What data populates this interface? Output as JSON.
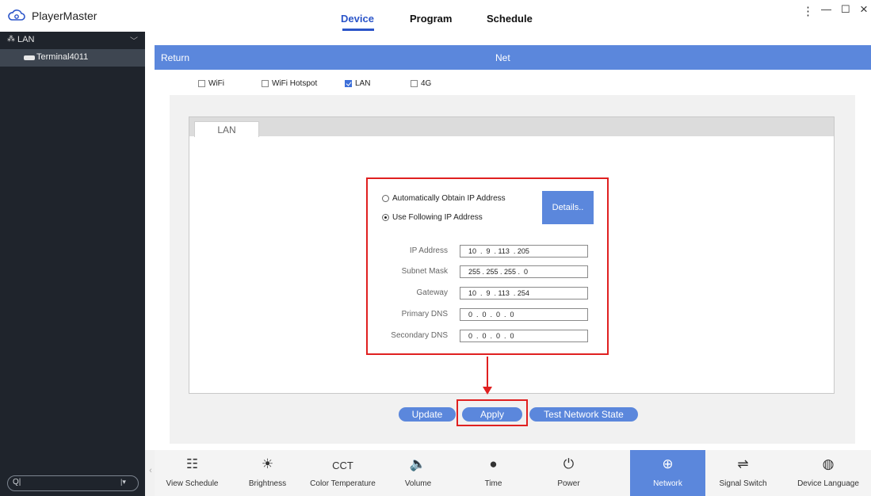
{
  "app": {
    "title": "PlayerMaster"
  },
  "nav": {
    "tabs": [
      {
        "label": "Device"
      },
      {
        "label": "Program"
      },
      {
        "label": "Schedule"
      }
    ],
    "active": "Device"
  },
  "window": {
    "menu": "⋮",
    "minimize": "—",
    "maximize": "☐",
    "close": "×"
  },
  "sidebar": {
    "root": {
      "label": "LAN"
    },
    "items": [
      {
        "label": "Terminal4011"
      }
    ]
  },
  "header": {
    "return_label": "Return",
    "title": "Net"
  },
  "net_types": [
    {
      "label": "WiFi",
      "checked": false
    },
    {
      "label": "WiFi Hotspot",
      "checked": false
    },
    {
      "label": "LAN",
      "checked": true
    },
    {
      "label": "4G",
      "checked": false
    }
  ],
  "lan_tab": {
    "label": "LAN"
  },
  "ip_mode": {
    "auto_label": "Automatically Obtain IP Address",
    "manual_label": "Use Following IP Address",
    "selected": "manual",
    "details_label": "Details.."
  },
  "fields": [
    {
      "label": "IP Address",
      "value": "10  .  9  . 113  . 205"
    },
    {
      "label": "Subnet Mask",
      "value": "255 . 255 . 255 .  0"
    },
    {
      "label": "Gateway",
      "value": "10  .  9  . 113  . 254"
    },
    {
      "label": "Primary DNS",
      "value": "0  .  0  .  0  .  0"
    },
    {
      "label": "Secondary DNS",
      "value": "0  .  0  .  0  .  0"
    }
  ],
  "actions": {
    "update": "Update",
    "apply": "Apply",
    "test": "Test Network State"
  },
  "toolbar": [
    {
      "label": "View Schedule",
      "icon": "view-schedule-icon",
      "glyph": "☷"
    },
    {
      "label": "Brightness",
      "icon": "brightness-icon",
      "glyph": "☀"
    },
    {
      "label": "Color Temperature",
      "icon": "color-temperature-icon",
      "glyph": "CCT"
    },
    {
      "label": "Volume",
      "icon": "volume-icon",
      "glyph": "🔈"
    },
    {
      "label": "Time",
      "icon": "time-icon",
      "glyph": "●"
    },
    {
      "label": "Power",
      "icon": "power-icon",
      "glyph": "⏻"
    },
    {
      "label": "Network",
      "icon": "network-icon",
      "glyph": "⊕"
    },
    {
      "label": "Signal Switch",
      "icon": "signal-switch-icon",
      "glyph": "⇌"
    },
    {
      "label": "Device Language",
      "icon": "device-language-icon",
      "glyph": "◍"
    }
  ],
  "toolbar_active": "Network",
  "colors": {
    "accent": "#5b87dc",
    "nav_active": "#2b55c9",
    "sidebar_bg": "#1f242c",
    "highlight_red": "#e02020"
  }
}
